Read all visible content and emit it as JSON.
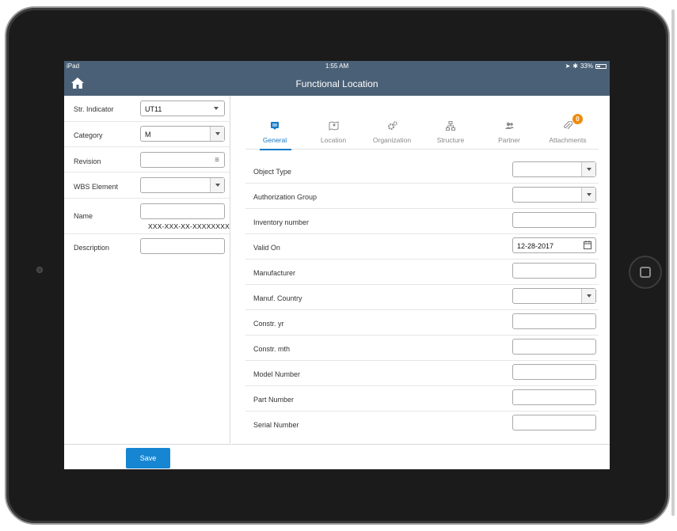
{
  "status_bar": {
    "device": "iPad",
    "time": "1:55 AM",
    "battery": "33%"
  },
  "nav": {
    "title": "Functional Location"
  },
  "left_panel": {
    "str_indicator": {
      "label": "Str. Indicator",
      "value": "UT11"
    },
    "category": {
      "label": "Category",
      "value": "M"
    },
    "revision": {
      "label": "Revision",
      "value": ""
    },
    "wbs_element": {
      "label": "WBS Element",
      "value": ""
    },
    "name": {
      "label": "Name",
      "value": "",
      "hint": "XXX-XXX-XX-XXXXXXXX"
    },
    "description": {
      "label": "Description",
      "value": ""
    },
    "save_label": "Save"
  },
  "tabs": [
    {
      "label": "General",
      "icon": "general-icon"
    },
    {
      "label": "Location",
      "icon": "map-icon"
    },
    {
      "label": "Organization",
      "icon": "gears-icon"
    },
    {
      "label": "Structure",
      "icon": "hierarchy-icon"
    },
    {
      "label": "Partner",
      "icon": "people-icon"
    },
    {
      "label": "Attachments",
      "icon": "paperclip-icon",
      "badge": "0"
    }
  ],
  "form": {
    "object_type": {
      "label": "Object Type",
      "value": ""
    },
    "authorization_group": {
      "label": "Authorization Group",
      "value": ""
    },
    "inventory_number": {
      "label": "Inventory number",
      "value": ""
    },
    "valid_on": {
      "label": "Valid On",
      "value": "12-28-2017"
    },
    "manufacturer": {
      "label": "Manufacturer",
      "value": ""
    },
    "manuf_country": {
      "label": "Manuf. Country",
      "value": ""
    },
    "constr_yr": {
      "label": "Constr. yr",
      "value": ""
    },
    "constr_mth": {
      "label": "Constr. mth",
      "value": ""
    },
    "model_number": {
      "label": "Model Number",
      "value": ""
    },
    "part_number": {
      "label": "Part Number",
      "value": ""
    },
    "serial_number": {
      "label": "Serial Number",
      "value": ""
    }
  },
  "colors": {
    "header": "#4a6076",
    "accent": "#1479c6",
    "save_button": "#1686d3",
    "badge": "#ef8a0a"
  }
}
